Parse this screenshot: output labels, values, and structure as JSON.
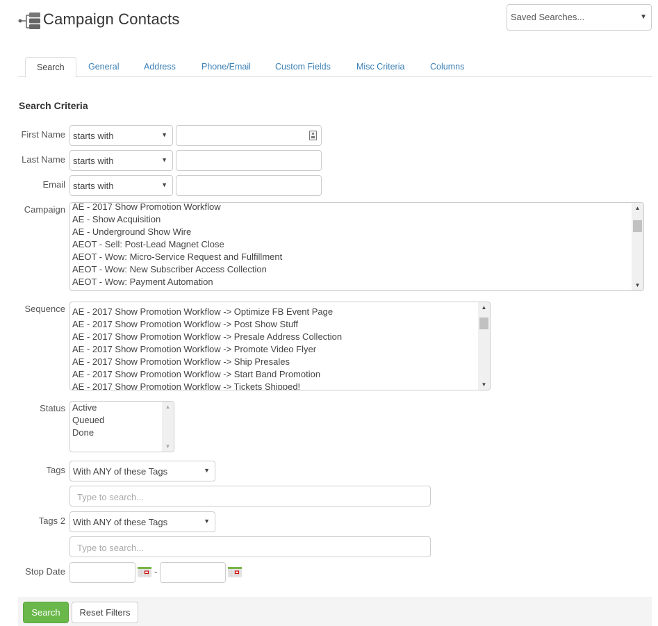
{
  "header": {
    "title": "Campaign Contacts",
    "saved_searches": {
      "selected": "Saved Searches...",
      "icon": "chevron-down-icon"
    }
  },
  "tabs": [
    {
      "label": "Search",
      "active": true
    },
    {
      "label": "General",
      "active": false
    },
    {
      "label": "Address",
      "active": false
    },
    {
      "label": "Phone/Email",
      "active": false
    },
    {
      "label": "Custom Fields",
      "active": false
    },
    {
      "label": "Misc Criteria",
      "active": false
    },
    {
      "label": "Columns",
      "active": false
    }
  ],
  "search_criteria": {
    "title": "Search Criteria",
    "first_name": {
      "label": "First Name",
      "operator": "starts with",
      "value": ""
    },
    "last_name": {
      "label": "Last Name",
      "operator": "starts with",
      "value": ""
    },
    "email": {
      "label": "Email",
      "operator": "starts with",
      "value": ""
    },
    "campaign": {
      "label": "Campaign",
      "options": [
        "AE - 2017 Show Promotion Workflow",
        "AE - Show Acquisition",
        "AE - Underground Show Wire",
        "AEOT - Sell: Post-Lead Magnet Close",
        "AEOT - Wow: Micro-Service Request and Fulfillment",
        "AEOT - Wow: New Subscriber Access Collection",
        "AEOT - Wow: Payment Automation"
      ]
    },
    "sequence": {
      "label": "Sequence",
      "options": [
        "AE - 2017 Show Promotion Workflow -> Optimize FB Event Page",
        "AE - 2017 Show Promotion Workflow -> Post Show Stuff",
        "AE - 2017 Show Promotion Workflow -> Presale Address Collection",
        "AE - 2017 Show Promotion Workflow -> Promote Video Flyer",
        "AE - 2017 Show Promotion Workflow -> Ship Presales",
        "AE - 2017 Show Promotion Workflow -> Start Band Promotion",
        "AE - 2017 Show Promotion Workflow -> Tickets Shipped!"
      ]
    },
    "status": {
      "label": "Status",
      "options": [
        "Active",
        "Queued",
        "Done"
      ]
    },
    "tags": {
      "label": "Tags",
      "operator": "With ANY of these Tags",
      "placeholder": "Type to search..."
    },
    "tags2": {
      "label": "Tags 2",
      "operator": "With ANY of these Tags",
      "placeholder": "Type to search..."
    },
    "stop_date": {
      "label": "Stop Date",
      "from": "",
      "to": "",
      "separator": "-"
    }
  },
  "actions": {
    "search_label": "Search",
    "reset_label": "Reset Filters",
    "search_color": "#6ab84a"
  }
}
